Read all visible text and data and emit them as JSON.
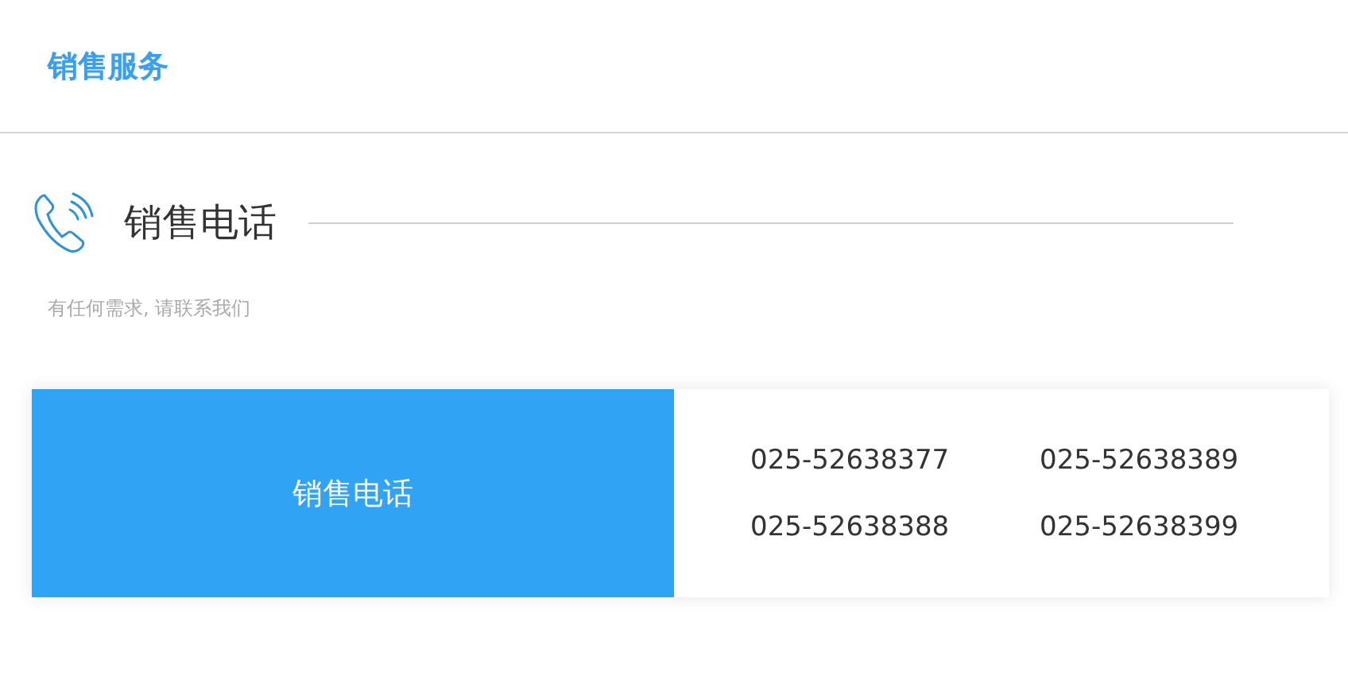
{
  "header": {
    "title": "销售服务"
  },
  "section": {
    "title": "销售电话",
    "subtitle": "有任何需求, 请联系我们"
  },
  "card": {
    "label": "销售电话",
    "phones": [
      "025-52638377",
      "025-52638389",
      "025-52638388",
      "025-52638399"
    ]
  }
}
